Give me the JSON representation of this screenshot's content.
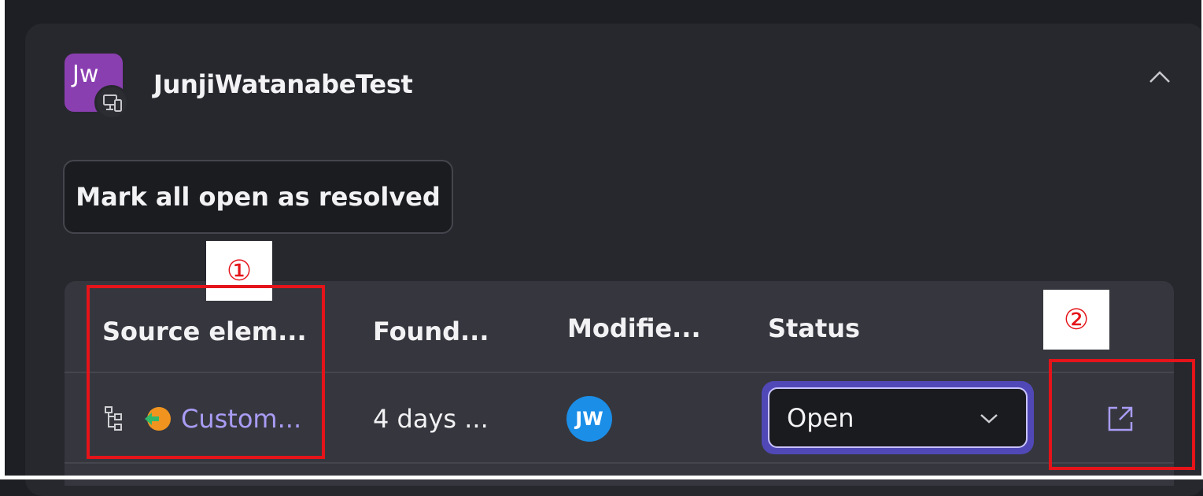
{
  "app": {
    "avatar_initials": "Jw",
    "name": "JunjiWatanabeTest"
  },
  "actions": {
    "mark_all_label": "Mark all open as resolved"
  },
  "table": {
    "headers": [
      "Source elem...",
      "Found...",
      "Modifie...",
      "Status"
    ],
    "rows": [
      {
        "source": "Custom...",
        "found": "4 days ...",
        "modified_by_initials": "JW",
        "status": "Open"
      }
    ]
  },
  "annotations": {
    "callout_1": "①",
    "callout_2": "②"
  },
  "colors": {
    "accent": "#a99cf5",
    "avatar_purple": "#8a3fb0",
    "user_blue": "#1b8ee8",
    "highlight_red": "#e4141a"
  }
}
